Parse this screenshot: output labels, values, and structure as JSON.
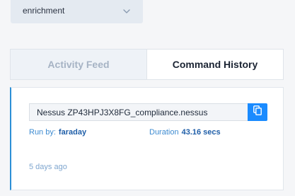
{
  "filter": {
    "selected": "enrichment"
  },
  "tabs": [
    {
      "label": "Activity Feed",
      "active": false
    },
    {
      "label": "Command History",
      "active": true
    }
  ],
  "command": {
    "file_name": "Nessus ZP43HPJ3X8FG_compliance.nessus",
    "run_by_label": "Run by:",
    "run_by_value": "faraday",
    "duration_label": "Duration",
    "duration_value": "43.16 secs",
    "time_ago": "5 days ago"
  },
  "colors": {
    "accent": "#1a8bff",
    "card_border_accent": "#2c8fd6",
    "link_blue": "#1f5ea8"
  },
  "icons": {
    "dropdown": "chevron-down-icon",
    "copy": "copy-icon"
  }
}
